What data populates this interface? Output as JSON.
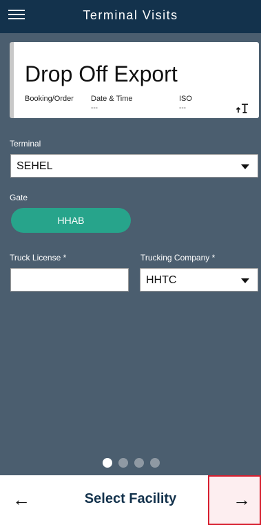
{
  "app": {
    "title": "Terminal Visits"
  },
  "card": {
    "title": "Drop Off Export",
    "booking_label": "Booking/Order",
    "date_time_label": "Date & Time",
    "date_time_value": "---",
    "iso_label": "ISO",
    "iso_value": "---"
  },
  "form": {
    "terminal_label": "Terminal",
    "terminal_value": "SEHEL",
    "gate_label": "Gate",
    "gate_value": "HHAB",
    "truck_license_label": "Truck License *",
    "truck_license_value": "",
    "trucking_company_label": "Trucking Company *",
    "trucking_company_value": "HHTC"
  },
  "pagination": {
    "total": 4,
    "active_index": 0
  },
  "bottom": {
    "back_symbol": "←",
    "title": "Select Facility",
    "next_symbol": "→"
  },
  "colors": {
    "topbar": "#13324c",
    "background": "#4b5e6f",
    "gate_accent": "#27a48b",
    "highlight_border": "#d71f2f"
  }
}
